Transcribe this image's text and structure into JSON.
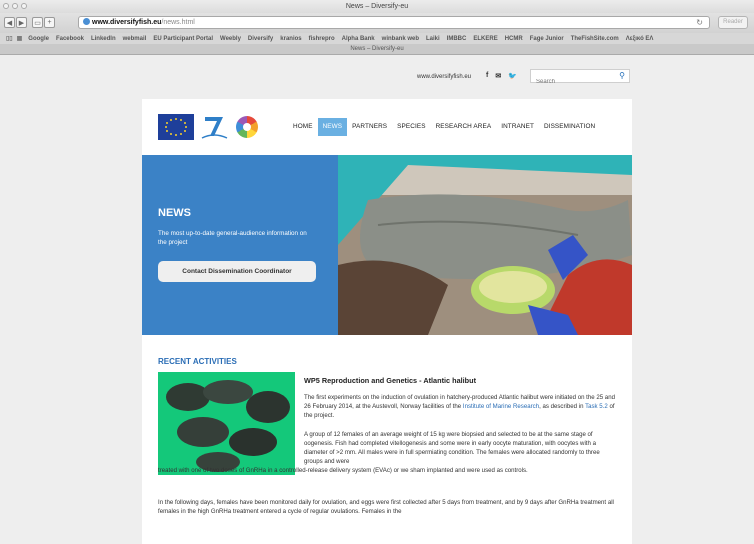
{
  "browser": {
    "window_title": "News – Diversify-eu",
    "url_domain": "www.diversifyfish.eu",
    "url_path": "/news.html",
    "reader_label": "Reader",
    "tab_title": "News – Diversify-eu",
    "bookmarks": [
      "Google",
      "Facebook",
      "LinkedIn",
      "webmail",
      "EU Participant Portal",
      "Weebly",
      "Diversify",
      "kranios",
      "fishrepro",
      "Alpha Bank",
      "winbank web",
      "Laiki",
      "IMBBC",
      "ELKERE",
      "HCMR",
      "Fage Junior",
      "TheFishSite.com",
      "Λεξικό ΕΛ"
    ]
  },
  "utility": {
    "site_url": "www.diversifyfish.eu",
    "search_placeholder": "Search"
  },
  "nav": {
    "items": [
      "HOME",
      "NEWS",
      "PARTNERS",
      "SPECIES",
      "RESEARCH AREA",
      "INTRANET",
      "DISSEMINATION"
    ],
    "active": "NEWS"
  },
  "hero": {
    "title": "NEWS",
    "subtitle": "The most up-to-date general-audience information on the project",
    "button": "Contact Dissemination Coordinator"
  },
  "recent": {
    "heading": "RECENT ACTIVITIES",
    "article_title": "WP5 Reproduction and Genetics - Atlantic halibut",
    "p1_a": "The first experiments on the induction of ovulation in hatchery-produced Atlantic halibut were initiated on the 25 and 26 February 2014, at the Austevoll, Norway facilities of the ",
    "p1_link1": "Institute of Marine Research",
    "p1_b": ", as described in ",
    "p1_link2": "Task 5.2",
    "p1_c": " of the project.",
    "p2_a": "A group of 12 females of an average weight of 15 kg were biopsied and selected to be at the same stage of oogenesis.  Fish had completed vitellogenesis and some were in early oocyte maturation, with oocytes with a diameter of >2 mm.  All males were in full spermiating condition.  The females were allocated randomly to three groups and were",
    "p2_b": "treated with one of two doses of GnRHa in a controlled-release delivery system (EVAc) or we sham implanted and were used as controls.",
    "p3": "In the following days, females have been monitored daily for ovulation, and eggs were first collected after 5 days from treatment, and by 9 days after GnRHa treatment all females in the high GnRHa treatment entered a cycle of regular ovulations.  Females in the"
  }
}
